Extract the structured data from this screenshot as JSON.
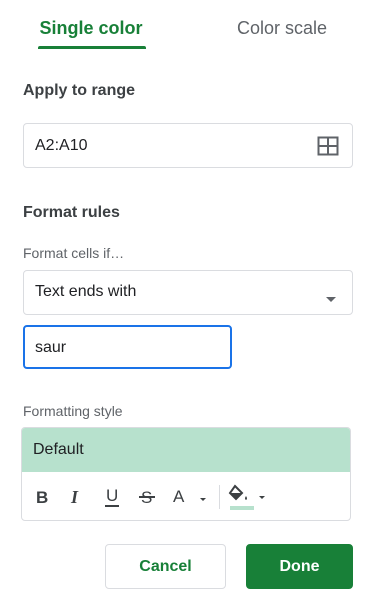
{
  "tabs": [
    {
      "label": "Single color",
      "active": true
    },
    {
      "label": "Color scale",
      "active": false
    }
  ],
  "apply_range": {
    "title": "Apply to range",
    "value": "A2:A10",
    "icon": "grid-icon"
  },
  "format_rules": {
    "title": "Format rules",
    "condition_label": "Format cells if…",
    "condition_value": "Text ends with",
    "value_input": "saur"
  },
  "formatting_style": {
    "label": "Formatting style",
    "preset": "Default",
    "preview_color": "#b7e1cd",
    "tools": [
      "bold-icon",
      "italic-icon",
      "underline-icon",
      "strikethrough-icon",
      "text-color-icon",
      "fill-color-icon"
    ]
  },
  "actions": {
    "cancel": "Cancel",
    "done": "Done"
  },
  "colors": {
    "accent": "#188038",
    "focus_border": "#1a73e8"
  }
}
